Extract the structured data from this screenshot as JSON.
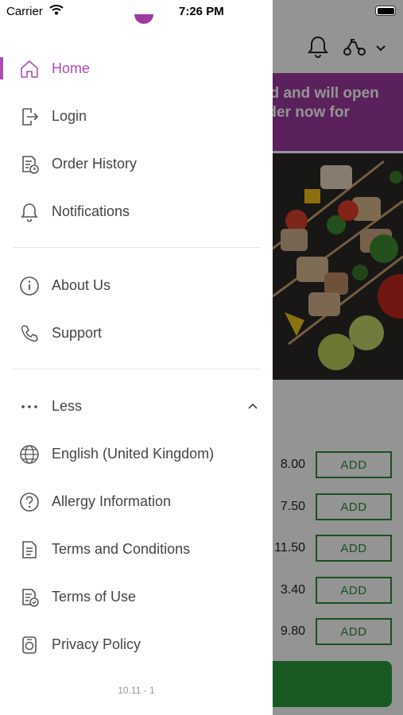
{
  "status_bar": {
    "carrier": "Carrier",
    "time": "7:26 PM"
  },
  "background": {
    "banner_lines": [
      "ed and will open",
      "rder now for"
    ],
    "prices": [
      "8.00",
      "7.50",
      "11.50",
      "3.40",
      "9.80"
    ],
    "add_label": "ADD"
  },
  "drawer": {
    "items": [
      {
        "label": "Home",
        "icon": "home-icon",
        "active": true
      },
      {
        "label": "Login",
        "icon": "login-icon"
      },
      {
        "label": "Order History",
        "icon": "order-history-icon"
      },
      {
        "label": "Notifications",
        "icon": "bell-icon"
      },
      {
        "label": "About Us",
        "icon": "info-icon"
      },
      {
        "label": "Support",
        "icon": "phone-icon"
      },
      {
        "label": "Less",
        "icon": "more-dots-icon"
      },
      {
        "label": "English (United Kingdom)",
        "icon": "globe-icon"
      },
      {
        "label": "Allergy Information",
        "icon": "question-icon"
      },
      {
        "label": "Terms and Conditions",
        "icon": "document-icon"
      },
      {
        "label": "Terms of Use",
        "icon": "document-check-icon"
      },
      {
        "label": "Privacy Policy",
        "icon": "privacy-icon"
      }
    ],
    "version": "10.11 - 1",
    "accent_color": "#b04cb3"
  }
}
